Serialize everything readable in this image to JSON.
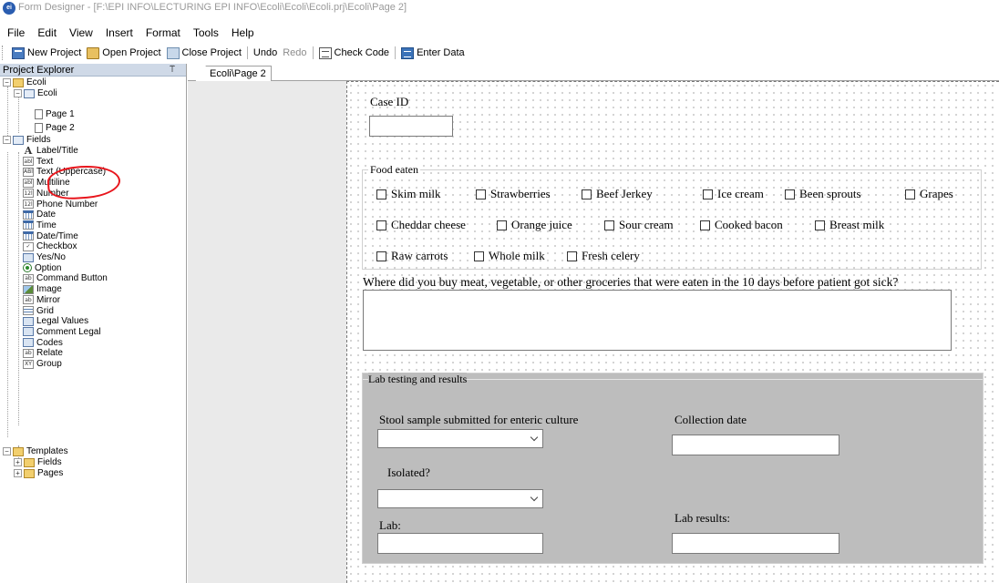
{
  "window": {
    "app_icon": "epi-info-logo-icon",
    "title": "Form Designer - [F:\\EPI INFO\\LECTURING EPI INFO\\Ecoli\\Ecoli\\Ecoli.prj\\Ecoli\\Page 2]"
  },
  "menu": [
    "File",
    "Edit",
    "View",
    "Insert",
    "Format",
    "Tools",
    "Help"
  ],
  "toolbar": {
    "new_project": "New Project",
    "open_project": "Open Project",
    "close_project": "Close Project",
    "undo": "Undo",
    "redo": "Redo",
    "check_code": "Check Code",
    "enter_data": "Enter Data"
  },
  "explorer": {
    "title": "Project Explorer",
    "pin": "⍡",
    "project": "Ecoli",
    "form": "Ecoli",
    "pages": [
      "Page 1",
      "Page 2"
    ],
    "fields_label": "Fields",
    "fields": [
      "Label/Title",
      "Text",
      "Text (Uppercase)",
      "Multiline",
      "Number",
      "Phone Number",
      "Date",
      "Time",
      "Date/Time",
      "Checkbox",
      "Yes/No",
      "Option",
      "Command Button",
      "Image",
      "Mirror",
      "Grid",
      "Legal Values",
      "Comment Legal",
      "Codes",
      "Relate",
      "Group"
    ],
    "field_icon_glyphs": [
      "A",
      "abl",
      "ABl",
      "abl",
      "12l",
      "12l",
      "",
      "",
      "",
      "✓",
      "",
      "",
      "ab",
      "",
      "ab",
      "",
      "",
      "",
      "",
      "ab",
      "XY"
    ],
    "templates_label": "Templates",
    "templates": [
      "Fields",
      "Pages"
    ]
  },
  "tab": {
    "label": "Ecoli\\Page 2"
  },
  "form": {
    "case_id_label": "Case ID",
    "food_group_title": "Food eaten",
    "foods": [
      "Skim milk",
      "Strawberries",
      "Beef Jerkey",
      "Ice cream",
      "Been sprouts",
      "Grapes",
      "Cheddar cheese",
      "Orange juice",
      "Sour cream",
      "Cooked bacon",
      "Breast milk",
      "Raw carrots",
      "Whole milk",
      "Fresh celery"
    ],
    "question": "Where did you buy meat, vegetable, or other groceries that were eaten in the 10 days before patient got sick?",
    "lab_group_title": "Lab testing and results",
    "stool_label": "Stool sample submitted for enteric culture",
    "collection_date_label": "Collection date",
    "isolated_label": "Isolated?",
    "lab_label": "Lab:",
    "lab_results_label": "Lab results:"
  }
}
